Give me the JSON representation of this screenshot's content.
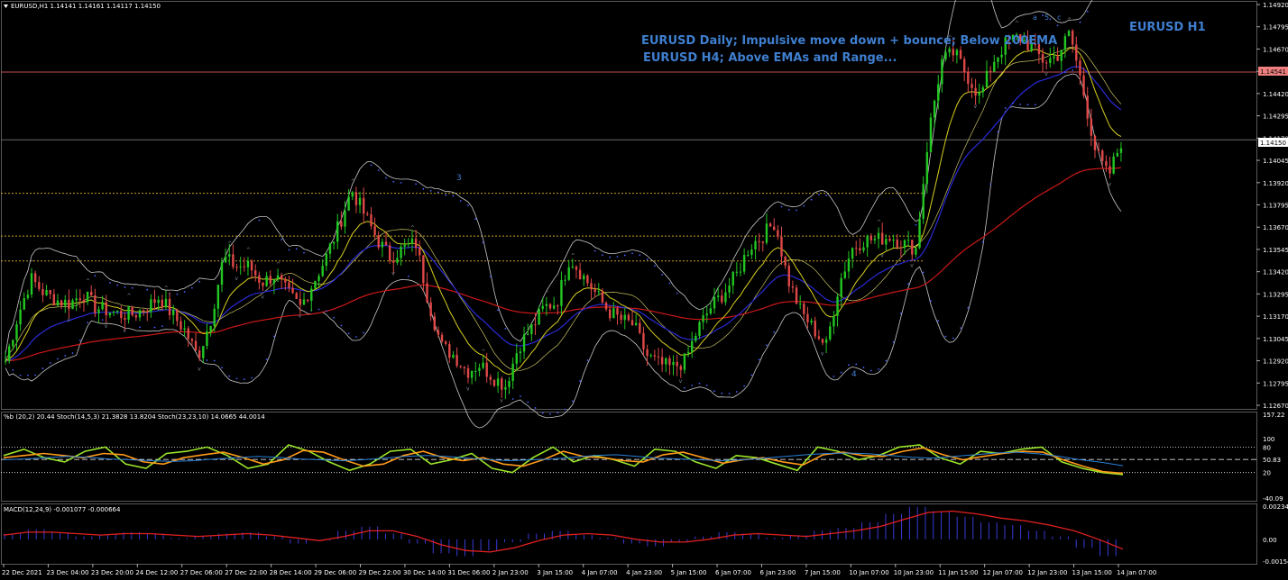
{
  "header": {
    "symbol_line": "EURUSD,H1  1.14141 1.14161 1.14117 1.14150",
    "oscillator_title": "%b (20,2) 20.44  Stoch(14,5,3) 21.3828 13.8204  Stoch(23,23,10) 14.0665 44.0014",
    "macd_title": "MACD(12,24,9) -0.001077 -0.000664"
  },
  "annotations": {
    "line1": "EURUSD Daily; Impulsive move down + bounce; Below 200EMA",
    "line2": "EURUSD H4; Above EMAs and Range...",
    "corner_label": "EURUSD H1",
    "wave_3": "3",
    "wave_4": "4",
    "wave_5": "5",
    "wave_a": "a",
    "wave_c": "c"
  },
  "colors": {
    "background": "#000000",
    "bull_candle": "#22c722",
    "bear_candle": "#e04848",
    "ema_slow": "#cc1818",
    "ema_mid": "#2a2ad8",
    "ema_fast": "#d8d020",
    "bollinger": "#c8c8c8",
    "psar": "#4a60ff",
    "annotation_text": "#3f7fd0",
    "current_price_bg": "#ffffff",
    "level_price_bg": "#f08080",
    "stoch_fast": "#9be52a",
    "stoch_slow": "#ff9a1a",
    "percent_b": "#2a80d8",
    "macd_hist": "#3a3ad8",
    "macd_signal": "#e02020"
  },
  "chart_data": [
    {
      "type": "line",
      "title": "EURUSD,H1",
      "subtitle": "1.14141 1.14161 1.14117 1.14150",
      "y_ticks": [
        "1.14920",
        "1.14795",
        "1.14670",
        "1.14545",
        "1.14420",
        "1.14295",
        "1.14170",
        "1.14045",
        "1.13920",
        "1.13795",
        "1.13670",
        "1.13545",
        "1.13420",
        "1.13295",
        "1.13170",
        "1.13045",
        "1.12920",
        "1.12795",
        "1.12670"
      ],
      "ylim": [
        1.1267,
        1.1492
      ],
      "x_ticks": [
        "22 Dec 2021",
        "23 Dec 04:00",
        "23 Dec 20:00",
        "24 Dec 12:00",
        "27 Dec 06:00",
        "27 Dec 22:00",
        "28 Dec 14:00",
        "29 Dec 06:00",
        "29 Dec 22:00",
        "30 Dec 14:00",
        "31 Dec 06:00",
        "2 Jan 23:00",
        "3 Jan 15:00",
        "4 Jan 07:00",
        "4 Jan 23:00",
        "5 Jan 15:00",
        "6 Jan 07:00",
        "6 Jan 23:00",
        "7 Jan 15:00",
        "10 Jan 07:00",
        "10 Jan 23:00",
        "11 Jan 15:00",
        "12 Jan 07:00",
        "12 Jan 23:00",
        "13 Jan 15:00",
        "14 Jan 07:00"
      ],
      "current_price": "1.14150",
      "marked_level": "1.14541",
      "horizontal_levels": [
        1.14541,
        1.1416,
        1.1386,
        1.1362,
        1.1348
      ],
      "series": [
        {
          "values": [
            1.1292,
            1.1318,
            1.1338,
            1.133,
            1.1326,
            1.1324,
            1.133,
            1.1322,
            1.132,
            1.1318,
            1.1318,
            1.1322,
            1.1328,
            1.1318,
            1.1309,
            1.1294,
            1.1315,
            1.135,
            1.1345,
            1.1345,
            1.1336,
            1.134,
            1.133,
            1.1322,
            1.1336,
            1.135,
            1.1368,
            1.1388,
            1.1374,
            1.136,
            1.135,
            1.1355,
            1.1358,
            1.1325,
            1.13,
            1.1295,
            1.1286,
            1.129,
            1.1283,
            1.1278,
            1.13,
            1.131,
            1.1322,
            1.1325,
            1.135,
            1.134,
            1.133,
            1.132,
            1.1315,
            1.1312,
            1.1295,
            1.129,
            1.1288,
            1.1292,
            1.131,
            1.1322,
            1.133,
            1.134,
            1.1356,
            1.1362,
            1.137,
            1.1338,
            1.132,
            1.131,
            1.13,
            1.1335,
            1.1355,
            1.136,
            1.136,
            1.1362,
            1.1358,
            1.1355,
            1.142,
            1.146,
            1.1465,
            1.1452,
            1.144,
            1.146,
            1.147,
            1.1474,
            1.1468,
            1.146,
            1.1463,
            1.1476,
            1.1445,
            1.141,
            1.1395,
            1.1415
          ]
        }
      ]
    },
    {
      "type": "line",
      "title": "%b (20,2) 20.44  Stoch(14,5,3) 21.3828 13.8204  Stoch(23,23,10) 14.0665 44.0014",
      "y_ticks": [
        "157.22",
        "80",
        "100",
        "50.83",
        "20",
        "-40.09"
      ],
      "series": [
        {
          "values": [
            60,
            75,
            55,
            45,
            70,
            80,
            40,
            30,
            65,
            70,
            80,
            60,
            30,
            40,
            85,
            70,
            45,
            25,
            40,
            70,
            75,
            40,
            50,
            65,
            30,
            20,
            55,
            80,
            45,
            60,
            50,
            35,
            75,
            70,
            45,
            30,
            60,
            55,
            40,
            25,
            80,
            70,
            50,
            60,
            80,
            85,
            55,
            40,
            70,
            65,
            75,
            80,
            45,
            30,
            20,
            15
          ]
        },
        {
          "values": [
            55,
            60,
            65,
            60,
            55,
            65,
            62,
            45,
            40,
            55,
            62,
            68,
            55,
            40,
            50,
            72,
            68,
            50,
            35,
            40,
            60,
            70,
            55,
            48,
            55,
            40,
            35,
            50,
            70,
            58,
            55,
            48,
            45,
            62,
            68,
            55,
            42,
            50,
            55,
            45,
            38,
            62,
            68,
            60,
            58,
            70,
            78,
            62,
            50,
            58,
            65,
            70,
            68,
            50,
            35,
            22,
            18
          ]
        },
        {
          "values": [
            50,
            52,
            55,
            58,
            56,
            52,
            50,
            48,
            46,
            48,
            52,
            55,
            58,
            56,
            52,
            50,
            48,
            50,
            54,
            58,
            60,
            58,
            54,
            50,
            48,
            50,
            52,
            56,
            60,
            62,
            58,
            54,
            52,
            50,
            48,
            50,
            54,
            58,
            62,
            65,
            66,
            64,
            60,
            56,
            54,
            58,
            62,
            66,
            68,
            64,
            58,
            50,
            44,
            36
          ]
        }
      ]
    },
    {
      "type": "bar",
      "title": "MACD(12,24,9) -0.001077 -0.000664",
      "y_ticks": [
        "0.002348",
        "0.00",
        "-0.001547"
      ],
      "series": [
        {
          "values": [
            0.0004,
            0.0007,
            0.0005,
            0.0002,
            0.0003,
            0.0005,
            0.0004,
            0.0001,
            0.0002,
            0.0004,
            0.0005,
            0.0002,
            -0.0003,
            -0.0001,
            0.0006,
            0.0009,
            0.0004,
            -0.0003,
            -0.001,
            -0.0012,
            -0.0008,
            -0.0002,
            0.0004,
            0.0006,
            0.0003,
            0.0001,
            -0.0003,
            -0.0005,
            -0.0002,
            0.0002,
            0.0005,
            0.0004,
            0.0001,
            0.0003,
            0.0006,
            0.0008,
            0.0012,
            0.0018,
            0.0023,
            0.002,
            0.0016,
            0.0012,
            0.001,
            0.0006,
            0.0002,
            -0.0006,
            -0.0012
          ]
        },
        {
          "values": [
            0.0003,
            0.0005,
            0.0005,
            0.0004,
            0.0003,
            0.0004,
            0.0004,
            0.0003,
            0.0002,
            0.0003,
            0.0004,
            0.0003,
            0.0001,
            -0.0001,
            0.0002,
            0.0006,
            0.0006,
            0.0002,
            -0.0004,
            -0.0008,
            -0.0009,
            -0.0006,
            -0.0001,
            0.0003,
            0.0004,
            0.0003,
            0.0,
            -0.0002,
            -0.0002,
            0.0,
            0.0003,
            0.0004,
            0.0003,
            0.0002,
            0.0004,
            0.0006,
            0.0009,
            0.0014,
            0.0019,
            0.002,
            0.0018,
            0.0015,
            0.0013,
            0.001,
            0.0006,
            0.0,
            -0.0007
          ]
        }
      ]
    }
  ]
}
